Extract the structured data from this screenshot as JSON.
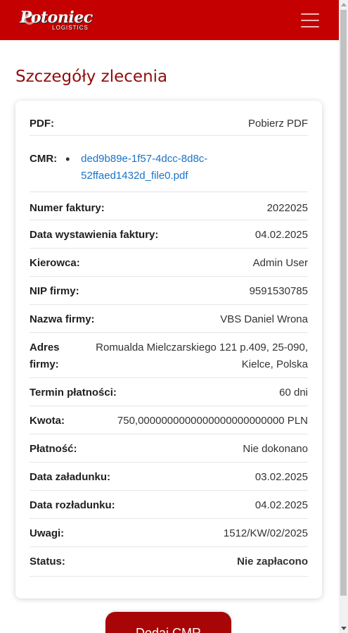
{
  "header": {
    "brand_name": "Potoniec",
    "brand_sub": "LOGISTICS",
    "menu_icon": "hamburger-icon",
    "color": "#c50000"
  },
  "page": {
    "title": "Szczegóły zlecenia"
  },
  "details": {
    "pdf": {
      "label": "PDF:",
      "link_text": "Pobierz PDF"
    },
    "cmr": {
      "label": "CMR:",
      "files": [
        "ded9b89e-1f57-4dcc-8d8c-52ffaed1432d_file0.pdf"
      ]
    },
    "invoice_number": {
      "label": "Numer faktury:",
      "value": "2022025"
    },
    "invoice_date": {
      "label": "Data wystawienia faktury:",
      "value": "04.02.2025"
    },
    "driver": {
      "label": "Kierowca:",
      "value": "Admin User"
    },
    "nip": {
      "label": "NIP firmy:",
      "value": "9591530785"
    },
    "company_name": {
      "label": "Nazwa firmy:",
      "value": "VBS Daniel Wrona"
    },
    "company_address": {
      "label_line1": "Adres",
      "label_line2": "firmy:",
      "value_line1": "Romualda Mielczarskiego 121 p.409, 25-090,",
      "value_line2": "Kielce, Polska"
    },
    "payment_term": {
      "label": "Termin płatności:",
      "value": "60 dni"
    },
    "amount": {
      "label": "Kwota:",
      "value": "750,0000000000000000000000000 PLN"
    },
    "payment": {
      "label": "Płatność:",
      "value": "Nie dokonano"
    },
    "loading_date": {
      "label": "Data załadunku:",
      "value": "03.02.2025"
    },
    "unloading_date": {
      "label": "Data rozładunku:",
      "value": "04.02.2025"
    },
    "notes": {
      "label": "Uwagi:",
      "value": "1512/KW/02/2025"
    },
    "status": {
      "label": "Status:",
      "value": "Nie zapłacono",
      "color": "#e00000"
    }
  },
  "actions": {
    "add_cmr_label": "Dodaj CMR"
  }
}
